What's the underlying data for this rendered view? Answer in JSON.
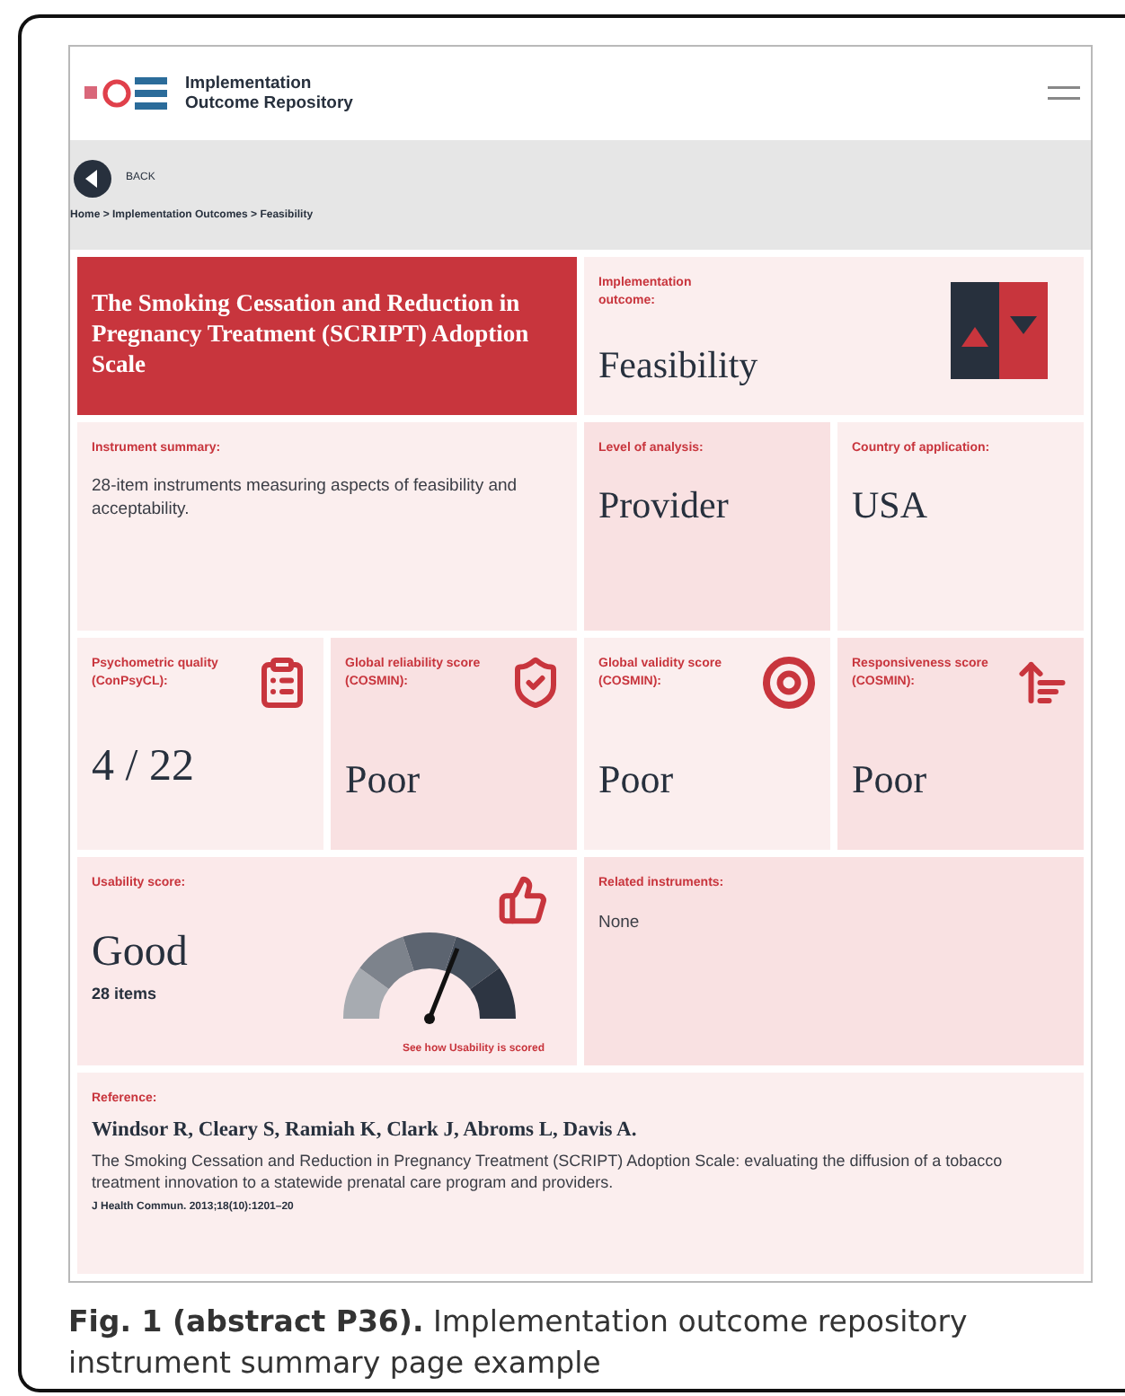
{
  "header": {
    "site_title": "Implementation Outcome Repository"
  },
  "nav": {
    "back_label": "BACK",
    "breadcrumb": "Home > Implementation Outcomes > Feasibility"
  },
  "instrument_title": "The Smoking Cessation and Reduction in Pregnancy Treatment (SCRIPT) Adoption Scale",
  "outcome": {
    "label": "Implementation outcome:",
    "value": "Feasibility"
  },
  "summary": {
    "label": "Instrument summary:",
    "text": "28-item instruments measuring aspects of feasibility and acceptability."
  },
  "level_of_analysis": {
    "label": "Level of analysis:",
    "value": "Provider"
  },
  "country": {
    "label": "Country of application:",
    "value": "USA"
  },
  "scores": [
    {
      "label": "Psychometric quality (ConPsyCL):",
      "value": "4 / 22",
      "kind": "clipboard"
    },
    {
      "label": "Global reliability score (COSMIN):",
      "value": "Poor",
      "kind": "shield"
    },
    {
      "label": "Global validity score (COSMIN):",
      "value": "Poor",
      "kind": "target"
    },
    {
      "label": "Responsiveness score (COSMIN):",
      "value": "Poor",
      "kind": "sort"
    }
  ],
  "usability": {
    "label": "Usability score:",
    "value": "Good",
    "items": "28 items",
    "link": "See how Usability is scored",
    "gauge": {
      "level": 0.62
    }
  },
  "related": {
    "label": "Related instruments:",
    "value": "None"
  },
  "reference": {
    "label": "Reference:",
    "authors": "Windsor R, Cleary S, Ramiah K, Clark J, Abroms L, Davis A.",
    "title": "The Smoking Cessation and Reduction in Pregnancy Treatment (SCRIPT) Adoption Scale: evaluating the diffusion of a tobacco treatment innovation to a statewide prenatal care program and providers.",
    "citation": "J Health Commun. 2013;18(10):1201–20"
  },
  "caption": "**Fig. 1 (abstract P36).** Implementation outcome repository instrument summary page example"
}
